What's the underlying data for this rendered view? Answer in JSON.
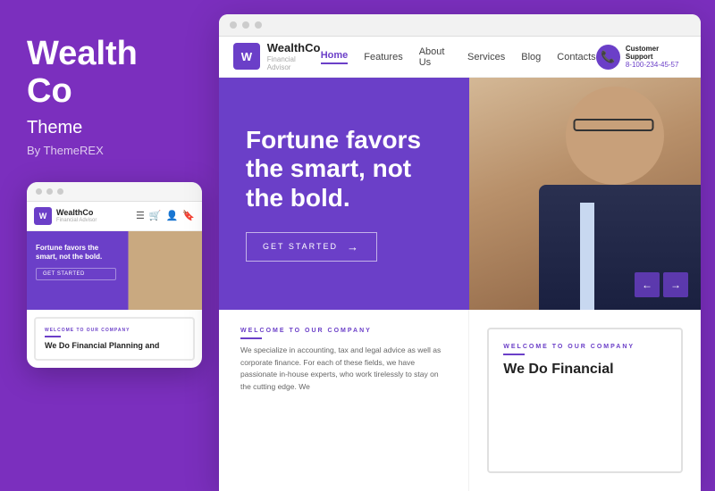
{
  "left": {
    "title_line1": "Wealth",
    "title_line2": "Co",
    "subtitle": "Theme",
    "by": "By ThemeREX"
  },
  "mobile": {
    "logo_name": "WealthCo",
    "logo_sub": "Financial Advisor",
    "hero_text": "Fortune favors the smart, not the bold.",
    "get_started": "GET STARTED",
    "section_label": "WELCOME TO OUR COMPANY",
    "section_title": "We Do Financial Planning and"
  },
  "browser": {
    "dots": [
      "",
      "",
      ""
    ],
    "nav": {
      "logo_name": "WealthCo",
      "logo_sub": "Financial Advisor",
      "links": [
        "Home",
        "Features",
        "About Us",
        "Services",
        "Blog",
        "Contacts"
      ],
      "active_link": "Home",
      "support_label": "Customer Support",
      "support_phone": "8-100-234-45-57"
    },
    "hero": {
      "headline_line1": "Fortune favors",
      "headline_line2": "the smart, not",
      "headline_line3": "the bold.",
      "btn_label": "GET STARTED",
      "btn_arrow": "→"
    },
    "bottom": {
      "left_label": "WELCOME TO OUR COMPANY",
      "left_text": "We specialize in accounting, tax and legal advice as well as corporate finance. For each of these fields, we have passionate in-house experts, who work tirelessly to stay on the cutting edge. We",
      "right_label": "WELCOME TO OUR COMPANY",
      "right_heading_line1": "We Do Financial"
    },
    "arrows": {
      "left": "←",
      "right": "→"
    }
  }
}
